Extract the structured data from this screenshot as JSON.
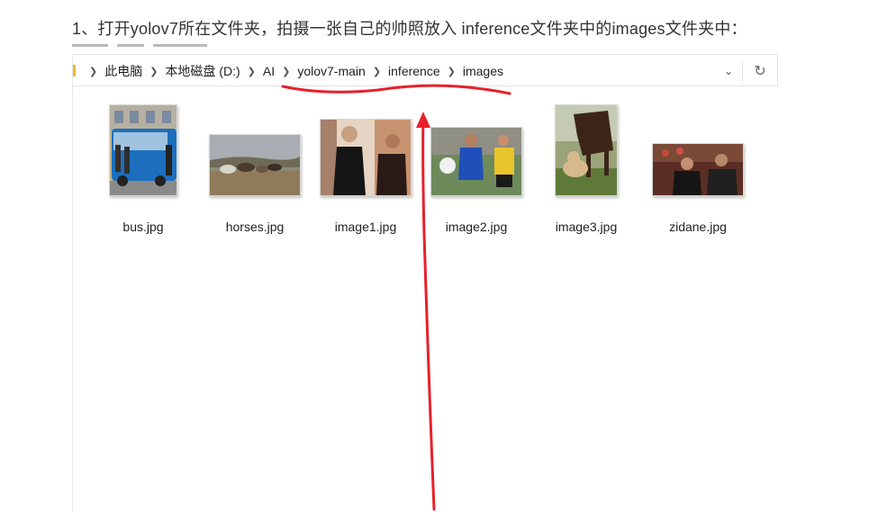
{
  "instruction": "1、打开yolov7所在文件夹，拍摄一张自己的帅照放入 inference文件夹中的images文件夹中：",
  "breadcrumb": [
    "此电脑",
    "本地磁盘 (D:)",
    "AI",
    "yolov7-main",
    "inference",
    "images"
  ],
  "files": [
    {
      "name": "bus.jpg"
    },
    {
      "name": "horses.jpg"
    },
    {
      "name": "image1.jpg"
    },
    {
      "name": "image2.jpg"
    },
    {
      "name": "image3.jpg"
    },
    {
      "name": "zidane.jpg"
    }
  ],
  "colors": {
    "annotation": "#e8202a",
    "folder": "#e9b93a"
  },
  "icons": {
    "dropdown": "chevron-down-icon",
    "refresh": "refresh-icon"
  }
}
